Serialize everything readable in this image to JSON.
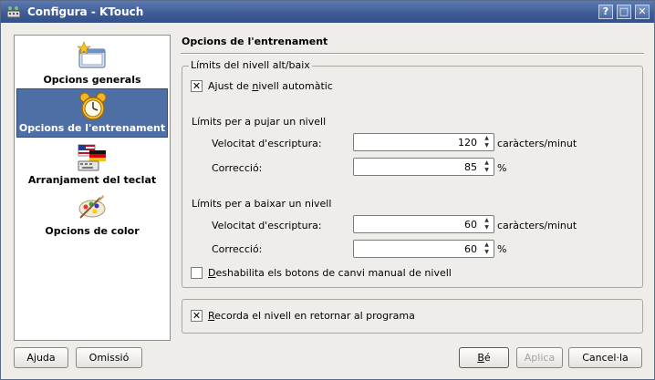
{
  "window": {
    "title": "Configura - KTouch",
    "buttons": {
      "help": "?",
      "maximize": "□",
      "close": "✕"
    }
  },
  "sidebar": {
    "items": [
      {
        "label": "Opcions generals",
        "icon": "general-options-icon",
        "selected": false
      },
      {
        "label": "Opcions de l'entrenament",
        "icon": "alarm-clock-icon",
        "selected": true
      },
      {
        "label": "Arranjament del teclat",
        "icon": "keyboard-flags-icon",
        "selected": false
      },
      {
        "label": "Opcions de color",
        "icon": "color-palette-icon",
        "selected": false
      }
    ]
  },
  "page": {
    "title": "Opcions de l'entrenament",
    "group_title": "Límits del nivell alt/baix",
    "auto_level": {
      "label_pre": "Ajust de ",
      "label_underlined": "n",
      "label_post": "ivell automàtic",
      "checked": true
    },
    "raise_section": "Límits per a pujar un nivell",
    "lower_section": "Límits per a baixar un nivell",
    "typing_speed_label": "Velocitat d'escriptura:",
    "correctness_label": "Correcció:",
    "raise_speed": "120",
    "raise_correct": "85",
    "lower_speed": "60",
    "lower_correct": "60",
    "speed_unit": "caràcters/minut",
    "percent_unit": "%",
    "disable_manual": {
      "label_pre": "",
      "label_underlined": "D",
      "label_post": "eshabilita els botons de canvi manual de nivell",
      "checked": false
    },
    "remember_level": {
      "label_pre": "",
      "label_underlined": "R",
      "label_post": "ecorda el nivell en retornar al programa",
      "checked": true
    }
  },
  "footer": {
    "help": "Ajuda",
    "defaults": "Omissió",
    "ok_underlined": "B",
    "ok_rest": "é",
    "apply": "Aplica",
    "cancel": "Cancel·la"
  },
  "colors": {
    "titlebar": "#3e5c96",
    "selection": "#4e6fa6"
  }
}
